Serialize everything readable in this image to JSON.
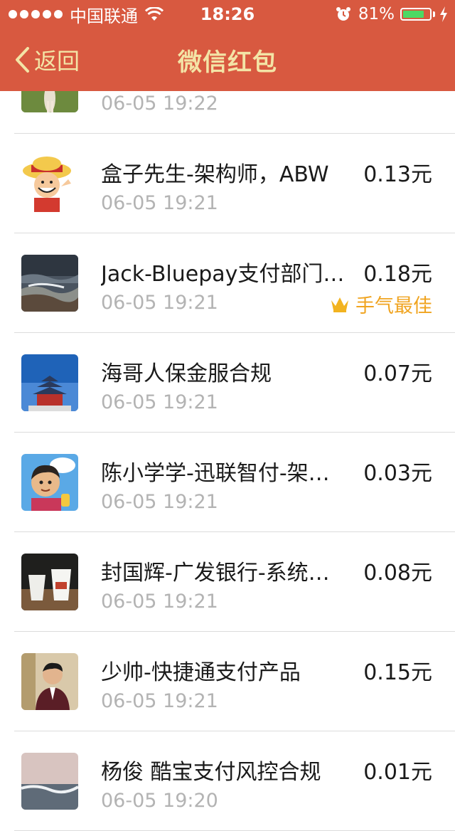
{
  "status_bar": {
    "carrier": "中国联通",
    "time": "18:26",
    "battery_percent": "81%",
    "battery_level": 0.81,
    "battery_color": "#4cd964"
  },
  "nav": {
    "back_label": "返回",
    "title": "微信红包"
  },
  "colors": {
    "header_bg": "#d85940",
    "title_text": "#f3e4a6",
    "best_luck": "#f0a420"
  },
  "records": [
    {
      "name": "",
      "amount": "",
      "time": "06-05 19:22",
      "avatar": "photo-person-icon",
      "best": ""
    },
    {
      "name": "盒子先生-架构师，ABW",
      "amount": "0.13元",
      "time": "06-05 19:21",
      "avatar": "cartoon-pirate-icon",
      "best": ""
    },
    {
      "name": "Jack-Bluepay支付部门…",
      "amount": "0.18元",
      "time": "06-05 19:21",
      "avatar": "seascape-photo-icon",
      "best": "手气最佳"
    },
    {
      "name": "海哥人保金服合规",
      "amount": "0.07元",
      "time": "06-05 19:21",
      "avatar": "temple-photo-icon",
      "best": ""
    },
    {
      "name": "陈小学学-迅联智付-架…",
      "amount": "0.03元",
      "time": "06-05 19:21",
      "avatar": "cartoon-boy-icon",
      "best": ""
    },
    {
      "name": "封国辉-广发银行-系统…",
      "amount": "0.08元",
      "time": "06-05 19:21",
      "avatar": "coffee-cups-photo-icon",
      "best": ""
    },
    {
      "name": "少帅-快捷通支付产品",
      "amount": "0.15元",
      "time": "06-05 19:21",
      "avatar": "man-portrait-photo-icon",
      "best": ""
    },
    {
      "name": "杨俊 酷宝支付风控合规",
      "amount": "0.01元",
      "time": "06-05 19:20",
      "avatar": "sea-photo-icon",
      "best": ""
    }
  ]
}
